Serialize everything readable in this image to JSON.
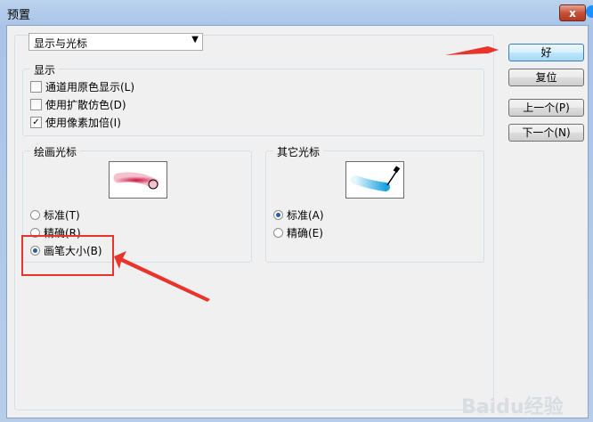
{
  "window": {
    "title": "预置",
    "close_glyph": "x"
  },
  "dropdown": {
    "value": "显示与光标"
  },
  "display_group": {
    "label": "显示",
    "checkboxes": [
      {
        "label": "通道用原色显示(L)",
        "checked": false
      },
      {
        "label": "使用扩散仿色(D)",
        "checked": false
      },
      {
        "label": "使用像素加倍(I)",
        "checked": true
      }
    ]
  },
  "paint_cursor_group": {
    "label": "绘画光标",
    "options": [
      {
        "label": "标准(T)",
        "selected": false
      },
      {
        "label": "精确(R)",
        "selected": false
      },
      {
        "label": "画笔大小(B)",
        "selected": true
      }
    ]
  },
  "other_cursor_group": {
    "label": "其它光标",
    "options": [
      {
        "label": "标准(A)",
        "selected": true
      },
      {
        "label": "精确(E)",
        "selected": false
      }
    ]
  },
  "buttons": {
    "ok": "好",
    "reset": "复位",
    "prev": "上一个(P)",
    "next": "下一个(N)"
  },
  "watermark": "Baidu经验",
  "colors": {
    "annotation_red": "#e8342b",
    "brush_red": "#c9143e",
    "brush_blue": "#1aa3e0"
  }
}
